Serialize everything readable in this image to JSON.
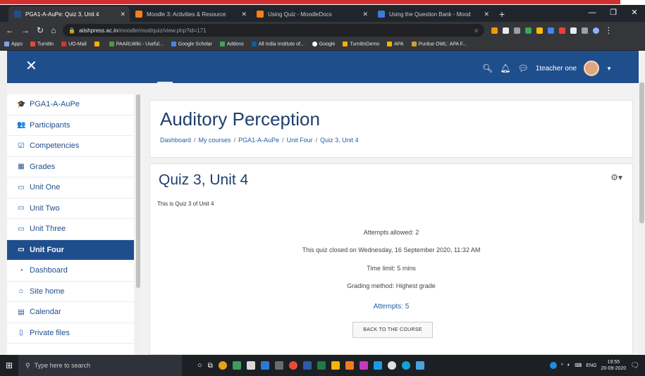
{
  "browser": {
    "tabs": [
      {
        "title": "PGA1-A-AuPe: Quiz 3, Unit 4",
        "color": "#1f4e8c"
      },
      {
        "title": "Moodle 3: Activities & Resource",
        "color": "#f98012"
      },
      {
        "title": "Using Quiz - MoodleDocs",
        "color": "#f98012"
      },
      {
        "title": "Using the Question Bank - Mood",
        "color": "#3b7bd8"
      }
    ],
    "url_domain": "aiishpress.ac.in",
    "url_path": "/moodle/mod/quiz/view.php?id=171",
    "bookmarks": [
      {
        "label": "Apps",
        "color": "#7aa7e6"
      },
      {
        "label": "Turnitin",
        "color": "#e04b3c"
      },
      {
        "label": "UO-Mail",
        "color": "#d9362b"
      },
      {
        "label": "",
        "color": "#f2b400"
      },
      {
        "label": "PAARLWiki - Useful...",
        "color": "#4d9d3b"
      },
      {
        "label": "Google Scholar",
        "color": "#4285f4"
      },
      {
        "label": "Addons",
        "color": "#3aa757"
      },
      {
        "label": "All India Institute of...",
        "color": "#0b5fa5"
      },
      {
        "label": "Google",
        "color": "#ffffff"
      },
      {
        "label": "TurnitinDemo",
        "color": "#f2b400"
      },
      {
        "label": "APA",
        "color": "#f2b400"
      },
      {
        "label": "Purdue OWL: APA F...",
        "color": "#c8a13a"
      }
    ]
  },
  "moodle": {
    "user_name": "1teacher one",
    "sidebar": [
      {
        "label": "PGA1-A-AuPe",
        "icon": "mortarboard-icon",
        "glyph": "🎓"
      },
      {
        "label": "Participants",
        "icon": "users-icon",
        "glyph": "👥"
      },
      {
        "label": "Competencies",
        "icon": "checkbox-icon",
        "glyph": "☑"
      },
      {
        "label": "Grades",
        "icon": "table-icon",
        "glyph": "▦"
      },
      {
        "label": "Unit One",
        "icon": "folder-icon",
        "glyph": "▭"
      },
      {
        "label": "Unit Two",
        "icon": "folder-icon",
        "glyph": "▭"
      },
      {
        "label": "Unit Three",
        "icon": "folder-icon",
        "glyph": "▭"
      },
      {
        "label": "Unit Four",
        "icon": "folder-icon",
        "glyph": "▭",
        "active": true
      },
      {
        "label": "Dashboard",
        "icon": "dashboard-icon",
        "glyph": "◔"
      },
      {
        "label": "Site home",
        "icon": "home-icon",
        "glyph": "⌂"
      },
      {
        "label": "Calendar",
        "icon": "calendar-icon",
        "glyph": "▤"
      },
      {
        "label": "Private files",
        "icon": "file-icon",
        "glyph": "▯"
      }
    ],
    "course_title": "Auditory Perception",
    "breadcrumbs": [
      "Dashboard",
      "My courses",
      "PGA1-A-AuPe",
      "Unit Four",
      "Quiz 3, Unit 4"
    ],
    "quiz_title": "Quiz 3, Unit 4",
    "quiz_intro": "This is Quiz 3 of Unit 4",
    "attempts_allowed": "Attempts allowed: 2",
    "closed_text": "This quiz closed on Wednesday, 16 September 2020, 11:32 AM",
    "time_limit": "Time limit: 5 mins",
    "grading_method": "Grading method: Highest grade",
    "attempts_link": "Attempts: 5",
    "back_button": "BACK TO THE COURSE"
  },
  "taskbar": {
    "search_placeholder": "Type here to search",
    "lang": "ENG",
    "time": "19:55",
    "date": "20-09-2020"
  }
}
